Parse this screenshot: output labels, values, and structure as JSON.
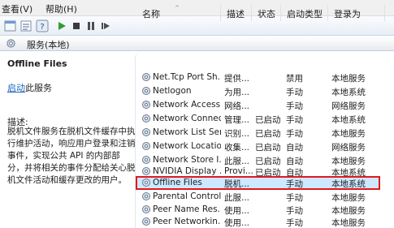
{
  "menubar": {
    "view": "查看(V)",
    "help": "帮助(H)"
  },
  "toolbar": {
    "icons": [
      "back-icon",
      "properties-icon",
      "help-icon",
      "play-icon",
      "stop-icon",
      "pause-icon",
      "restart-icon"
    ]
  },
  "panel": {
    "title": "服务(本地)"
  },
  "details": {
    "service_name": "Offline Files",
    "start_link": "启动",
    "start_suffix": "此服务",
    "desc_label": "描述:",
    "description": "脱机文件服务在脱机文件缓存中执行维护活动，响应用户登录和注销事件，实现公共 API 的内部部分，并将相关的事件分配给关心脱机文件活动和缓存更改的用户。"
  },
  "columns": {
    "name": "名称",
    "desc": "描述",
    "status": "状态",
    "startup": "启动类型",
    "logon": "登录为"
  },
  "services": [
    {
      "name": "Net.Tcp Port Sh...",
      "desc": "提供...",
      "status": "",
      "startup": "禁用",
      "logon": "本地服务"
    },
    {
      "name": "Netlogon",
      "desc": "为用...",
      "status": "",
      "startup": "手动",
      "logon": "本地系统"
    },
    {
      "name": "Network Access ...",
      "desc": "网络...",
      "status": "",
      "startup": "手动",
      "logon": "网络服务"
    },
    {
      "name": "Network Connec...",
      "desc": "管理...",
      "status": "已启动",
      "startup": "手动",
      "logon": "本地系统"
    },
    {
      "name": "Network List Ser...",
      "desc": "识别...",
      "status": "已启动",
      "startup": "手动",
      "logon": "本地服务"
    },
    {
      "name": "Network Locatio...",
      "desc": "收集...",
      "status": "已启动",
      "startup": "自动",
      "logon": "网络服务"
    },
    {
      "name": "Network Store I...",
      "desc": "此服...",
      "status": "已启动",
      "startup": "自动",
      "logon": "本地服务"
    },
    {
      "name": "NVIDIA Display ...",
      "desc": "Provi...",
      "status": "已启动",
      "startup": "自动",
      "logon": "本地系统"
    },
    {
      "name": "Offline Files",
      "desc": "脱机...",
      "status": "",
      "startup": "手动",
      "logon": "本地系统"
    },
    {
      "name": "Parental Controls",
      "desc": "此服...",
      "status": "",
      "startup": "手动",
      "logon": "本地服务"
    },
    {
      "name": "Peer Name Res...",
      "desc": "使用...",
      "status": "",
      "startup": "手动",
      "logon": "本地服务"
    },
    {
      "name": "Peer Networkin...",
      "desc": "使用...",
      "status": "",
      "startup": "手动",
      "logon": "本地服务"
    }
  ],
  "colors": {
    "selection_outline": "#e0191f",
    "link": "#1a63b8",
    "play": "#2e9e35"
  }
}
